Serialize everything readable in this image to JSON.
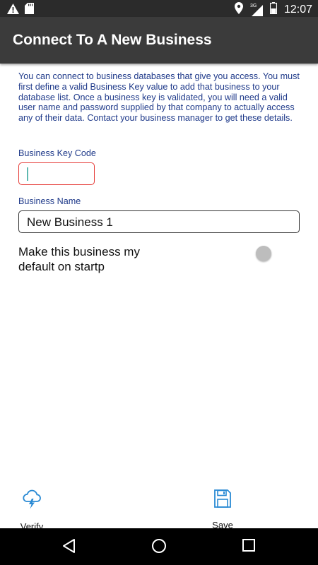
{
  "status_bar": {
    "time": "12:07",
    "network_label": "3G",
    "icons": [
      "warning-icon",
      "sd-card-icon",
      "location-icon",
      "signal-icon",
      "battery-icon"
    ]
  },
  "app_bar": {
    "title": "Connect To A New Business"
  },
  "form": {
    "intro_text": "You can connect to business databases that give you access. You must first define a valid Business Key value to add that business to your database list. Once a business key is validated, you will need a valid user name and password supplied by that company to actually access any of their data. Contact your business manager to get these details.",
    "business_key_label": "Business Key Code",
    "business_key_value": "",
    "business_name_label": "Business Name",
    "business_name_value": "New Business 1",
    "default_label": "Make this business my default on startp",
    "default_enabled": false
  },
  "actions": {
    "verify_label": "Verify",
    "save_label": "Save"
  },
  "nav": {
    "icons": [
      "back-icon",
      "home-icon",
      "recents-icon"
    ]
  },
  "colors": {
    "accent_blue": "#1f3a8a",
    "icon_blue": "#2a8ad4",
    "error_red": "#e53935",
    "app_bar": "#3b3b3b",
    "status_bar": "#2b2b2b"
  }
}
